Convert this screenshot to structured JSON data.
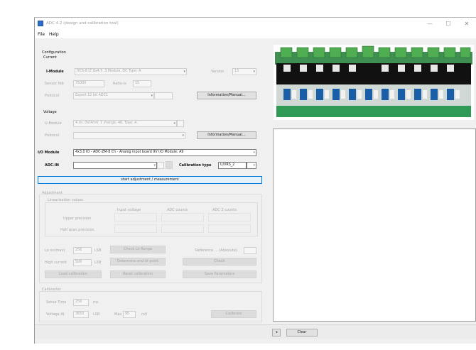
{
  "window": {
    "title": "ADC 4.2 (design and calibration tool)",
    "minimize": "—",
    "maximize": "☐",
    "close": "✕"
  },
  "menu": {
    "file": "File",
    "help": "Help"
  },
  "config": {
    "heading": "Configuration",
    "current": {
      "label": "Current",
      "module_label": "I-Module",
      "module_value": "HCS-8 LT 8x4.5 .3 Module, DC Type: A",
      "version_label": "Version",
      "version_value": "13",
      "sense_label": "Sensor fdb",
      "sense_value": "75000",
      "ratio_label": "Ratio-is",
      "ratio_value": "15",
      "protocol_label": "Protocol",
      "protocol_value": "Export 12 bit ADC1",
      "manual_btn": "Information/Manual..."
    },
    "voltage": {
      "label": "Voltage",
      "module_label": "U-Module",
      "module_value": "4 ch. 0V/4mV: 1 Vrange: 46, Type: A",
      "protocol_label": "Protocol",
      "protocol_value": "",
      "manual_btn": "Information/Manual..."
    },
    "io_module_label": "I/O Module",
    "io_module_value": "4x3,0 IO - ADC-ZM-8 Ch - Analog input board 9V  I/O Module: A9",
    "adc_label": "ADC-IN",
    "adc_value": "",
    "calibration_type_label": "Calibration type",
    "calibration_type_value": "U/VRS_2",
    "start_button": "start adjustment / measurement"
  },
  "adjustment": {
    "heading": "Adjustment",
    "consistent_label": "Linearisation values",
    "cols": [
      "Input voltage",
      "ADC counts",
      "ADC 2 counts"
    ],
    "rows": [
      "Upper precision",
      "Half span precision"
    ],
    "lo_label": "Lo no(max)",
    "lo_value": "256",
    "lo_unit": "LSB",
    "hi_label": "High current",
    "hi_value": "500",
    "hi_unit": "LSB",
    "btn_assign_lo": "Check Lo Range",
    "btn_assign_hi": "Determine end of point",
    "btn_load_cal": "Load calibration",
    "btn_restore": "Reset calibration",
    "reference_label": "Reference ... (Absolute)",
    "btn_check": "Check",
    "btn_save_params": "Save Parameters"
  },
  "calibration": {
    "heading": "Calibration",
    "setup_label": "Setup Time",
    "setup_value": "250",
    "setup_unit": "ms",
    "setup2_label": "Voltage At",
    "setup2_value": "3650",
    "setup2_unit": "LSB",
    "max_label": "Max",
    "max_value": "95",
    "max_unit": "mV",
    "btn_calibrate": "Calibrate"
  },
  "status": {
    "left_btn": "◂",
    "clear_btn": "Clear"
  }
}
